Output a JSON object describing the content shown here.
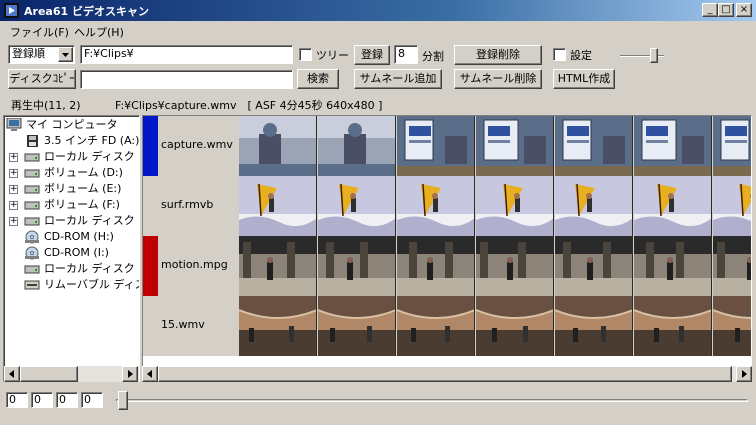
{
  "window": {
    "title": "Area61 ビデオスキャン",
    "controls": {
      "minimize": "_",
      "maximize": "□",
      "close": "×"
    }
  },
  "menu": {
    "items": [
      {
        "label": "ファイル(F)"
      },
      {
        "label": "ヘルプ(H)"
      }
    ]
  },
  "toolbar": {
    "sort_select": "登録順",
    "path_input": "F:¥Clips¥",
    "tree_checkbox_label": "ツリー",
    "register_label": "登録",
    "split_value": "8",
    "split_unit": "分割",
    "delete_registration_label": "登録削除",
    "settings_label": "設定",
    "disc_copy_label": "ディスクｺﾋﾟｰ",
    "search_input": "",
    "search_label": "検索",
    "add_thumbnail_label": "サムネール追加",
    "delete_thumbnail_label": "サムネール削除",
    "html_label": "HTML作成"
  },
  "status": {
    "playing": "再生中(11, 2)",
    "file_info": "F:¥Clips¥capture.wmv　[ ASF 4分45秒 640x480 ]"
  },
  "tree": {
    "root": "マイ コンピュータ",
    "items": [
      {
        "label": "3.5 インチ FD (A:)",
        "icon": "floppy-icon",
        "expandable": false
      },
      {
        "label": "ローカル ディスク",
        "icon": "hard-drive-icon",
        "expandable": true
      },
      {
        "label": "ボリューム (D:)",
        "icon": "hard-drive-icon",
        "expandable": true
      },
      {
        "label": "ボリューム (E:)",
        "icon": "hard-drive-icon",
        "expandable": true
      },
      {
        "label": "ボリューム (F:)",
        "icon": "hard-drive-icon",
        "expandable": true
      },
      {
        "label": "ローカル ディスク",
        "icon": "hard-drive-icon",
        "expandable": true
      },
      {
        "label": "CD-ROM (H:)",
        "icon": "cd-rom-icon",
        "expandable": false
      },
      {
        "label": "CD-ROM (I:)",
        "icon": "cd-rom-icon",
        "expandable": false
      },
      {
        "label": "ローカル ディスク",
        "icon": "hard-drive-icon",
        "expandable": false
      },
      {
        "label": "リムーバブル ディスク",
        "icon": "removable-drive-icon",
        "expandable": false
      }
    ]
  },
  "videos": [
    {
      "name": "capture.wmv",
      "marker_color": "#0018c8",
      "palette": [
        "#5a6e8a",
        "#9aa4b4",
        "#4a4f66",
        "#c8cedc"
      ]
    },
    {
      "name": "surf.rmvb",
      "marker_color": "",
      "palette": [
        "#c7c8e0",
        "#e8b020",
        "#6f6fa8",
        "#f0f0f4"
      ]
    },
    {
      "name": "motion.mpg",
      "marker_color": "#c00000",
      "palette": [
        "#4a443c",
        "#8c8478",
        "#2a2a2a",
        "#b8b0a0"
      ]
    },
    {
      "name": "15.wmv",
      "marker_color": "",
      "palette": [
        "#b08868",
        "#d8c0a4",
        "#6a5040",
        "#4a3c30"
      ]
    }
  ],
  "playback": {
    "counters": [
      "0",
      "0",
      "0",
      "0"
    ],
    "position": 0
  }
}
